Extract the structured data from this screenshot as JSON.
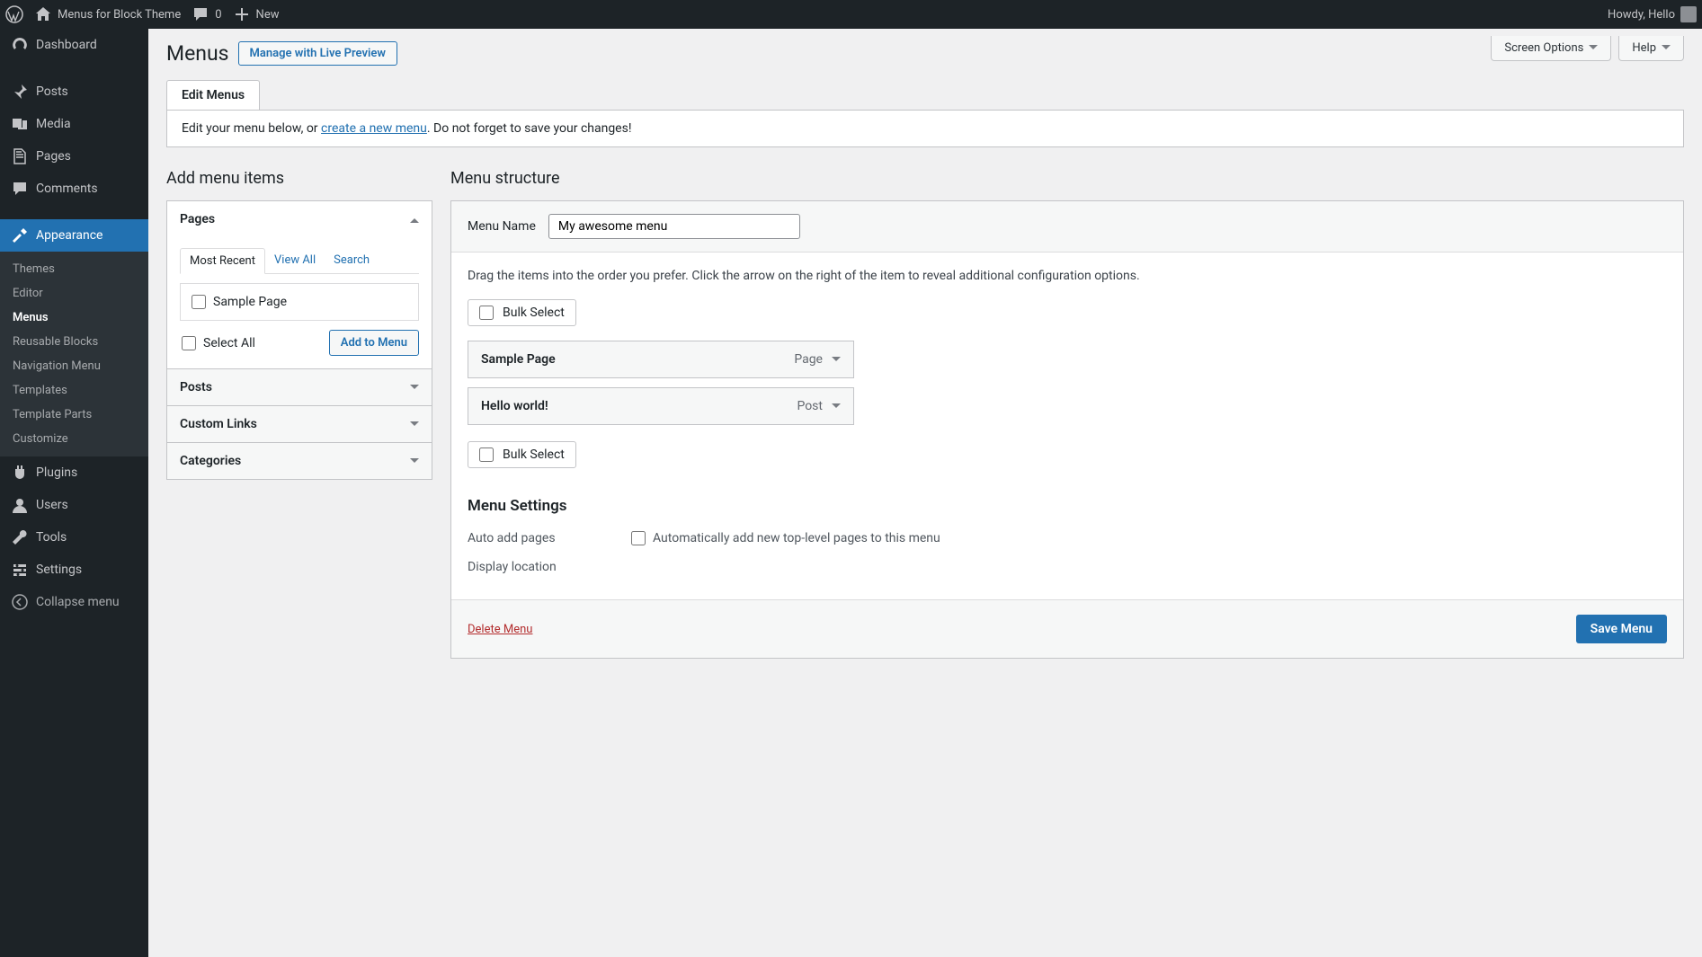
{
  "adminbar": {
    "site_title": "Menus for Block Theme",
    "comments_count": "0",
    "new_label": "New",
    "greeting": "Howdy, Hello"
  },
  "sidebar": {
    "items": [
      {
        "icon": "dashboard",
        "label": "Dashboard"
      },
      {
        "icon": "pin",
        "label": "Posts"
      },
      {
        "icon": "media",
        "label": "Media"
      },
      {
        "icon": "page",
        "label": "Pages"
      },
      {
        "icon": "comment",
        "label": "Comments"
      },
      {
        "icon": "appearance",
        "label": "Appearance",
        "active": true
      },
      {
        "icon": "plugin",
        "label": "Plugins"
      },
      {
        "icon": "user",
        "label": "Users"
      },
      {
        "icon": "tools",
        "label": "Tools"
      },
      {
        "icon": "settings",
        "label": "Settings"
      }
    ],
    "submenu": [
      "Themes",
      "Editor",
      "Menus",
      "Reusable Blocks",
      "Navigation Menu",
      "Templates",
      "Template Parts",
      "Customize"
    ],
    "submenu_current_index": 2,
    "collapse_label": "Collapse menu"
  },
  "header": {
    "title": "Menus",
    "live_preview_btn": "Manage with Live Preview",
    "screen_options": "Screen Options",
    "help": "Help"
  },
  "tab_label": "Edit Menus",
  "info": {
    "prefix": "Edit your menu below, or ",
    "link": "create a new menu",
    "suffix": ". Do not forget to save your changes!"
  },
  "add_items": {
    "heading": "Add menu items",
    "sections": [
      "Pages",
      "Posts",
      "Custom Links",
      "Categories"
    ],
    "pages_tabs": [
      "Most Recent",
      "View All",
      "Search"
    ],
    "page_item": "Sample Page",
    "select_all": "Select All",
    "add_btn": "Add to Menu"
  },
  "structure": {
    "heading": "Menu structure",
    "name_label": "Menu Name",
    "name_value": "My awesome menu",
    "description": "Drag the items into the order you prefer. Click the arrow on the right of the item to reveal additional configuration options.",
    "bulk_select": "Bulk Select",
    "items": [
      {
        "title": "Sample Page",
        "type": "Page"
      },
      {
        "title": "Hello world!",
        "type": "Post"
      }
    ],
    "settings_heading": "Menu Settings",
    "auto_add_label": "Auto add pages",
    "auto_add_check": "Automatically add new top-level pages to this menu",
    "display_location_label": "Display location",
    "delete_link": "Delete Menu",
    "save_btn": "Save Menu"
  }
}
